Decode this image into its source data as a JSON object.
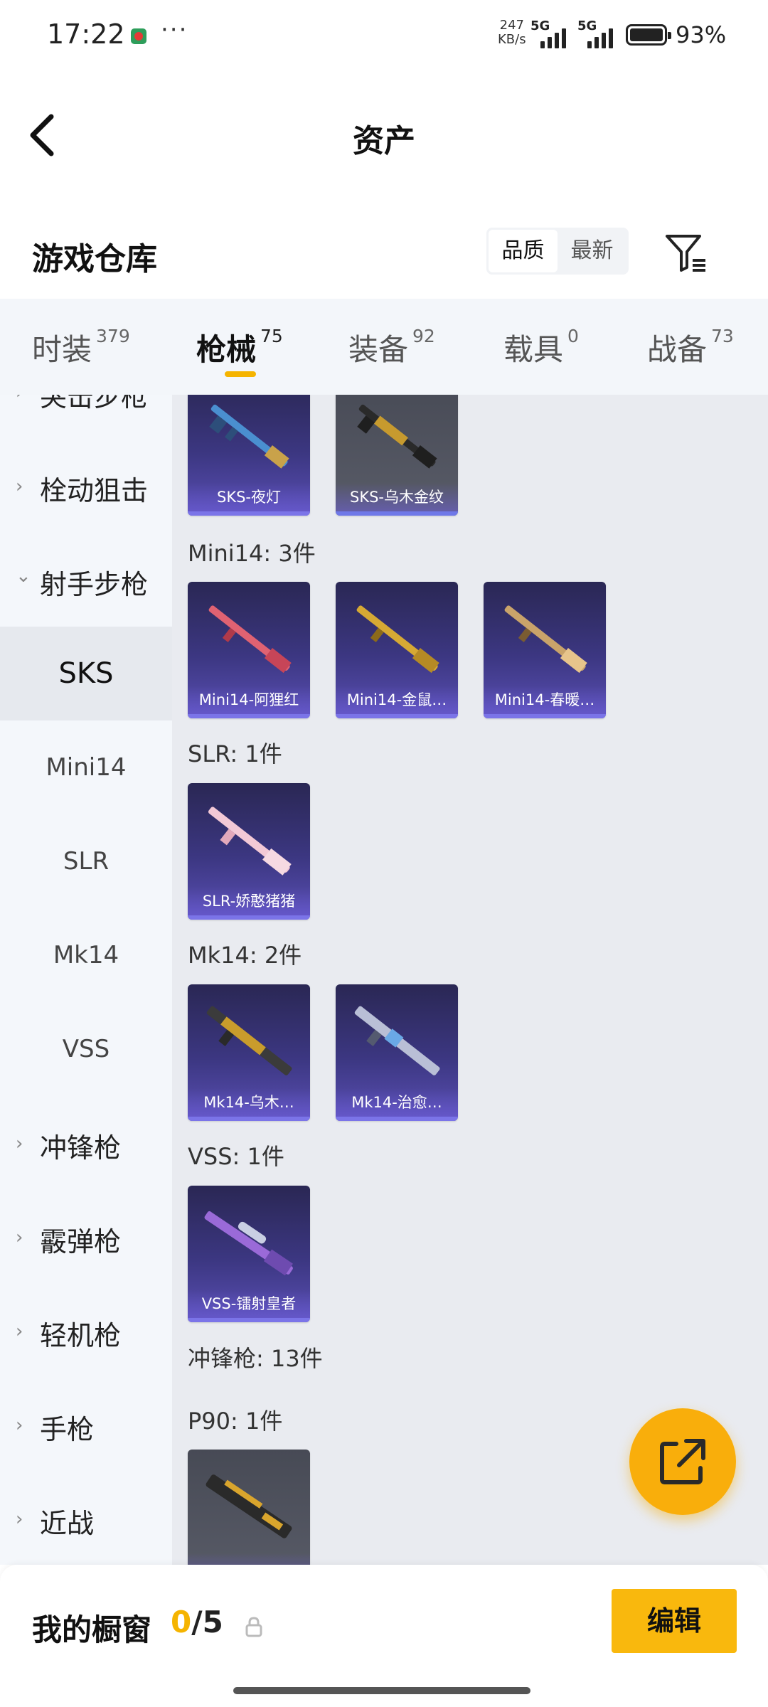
{
  "status_bar": {
    "time": "17:22",
    "more": "···",
    "net_speed_value": "247",
    "net_speed_unit": "KB/s",
    "signal_1": "5G",
    "signal_2": "5G",
    "battery": "93%",
    "battery_level": 0.93,
    "icons": [
      "notification-app-icon",
      "signal-icon",
      "battery-icon"
    ]
  },
  "header": {
    "title": "资产",
    "back_icon": "chevron-left-icon"
  },
  "warehouse": {
    "title": "游戏仓库",
    "sort_options": [
      "品质",
      "最新"
    ],
    "sort_active": "品质",
    "filter_icon": "filter-icon"
  },
  "tabs": [
    {
      "label": "时装",
      "count": "379"
    },
    {
      "label": "枪械",
      "count": "75",
      "active": true
    },
    {
      "label": "装备",
      "count": "92"
    },
    {
      "label": "载具",
      "count": "0"
    },
    {
      "label": "战备",
      "count": "73"
    }
  ],
  "sidebar": {
    "categories": [
      {
        "label": "突击步枪"
      },
      {
        "label": "栓动狙击"
      },
      {
        "label": "射手步枪",
        "expanded": true
      },
      {
        "label": "冲锋枪"
      },
      {
        "label": "霰弹枪"
      },
      {
        "label": "轻机枪"
      },
      {
        "label": "手枪"
      },
      {
        "label": "近战"
      }
    ],
    "subcategories": [
      {
        "label": "SKS",
        "active": true
      },
      {
        "label": "Mini14"
      },
      {
        "label": "SLR"
      },
      {
        "label": "Mk14"
      },
      {
        "label": "VSS"
      }
    ]
  },
  "content": {
    "sks_items": [
      {
        "name": "SKS-夜灯"
      },
      {
        "name": "SKS-乌木金纹"
      }
    ],
    "groups": [
      {
        "title": "Mini14: 3件",
        "items": [
          {
            "name": "Mini14-阿狸红"
          },
          {
            "name": "Mini14-金鼠…"
          },
          {
            "name": "Mini14-春暖…"
          }
        ]
      },
      {
        "title": "SLR: 1件",
        "items": [
          {
            "name": "SLR-娇憨猪猪"
          }
        ]
      },
      {
        "title": "Mk14: 2件",
        "items": [
          {
            "name": "Mk14-乌木…"
          },
          {
            "name": "Mk14-治愈…"
          }
        ]
      },
      {
        "title": "VSS: 1件",
        "items": [
          {
            "name": "VSS-镭射皇者"
          }
        ]
      },
      {
        "title": "冲锋枪: 13件",
        "items": []
      },
      {
        "title": "P90: 1件",
        "items": []
      }
    ]
  },
  "fab": {
    "icon": "share-icon"
  },
  "bottom_bar": {
    "label": "我的橱窗",
    "current": "0",
    "total": "/5",
    "lock_icon": "lock-icon",
    "edit_label": "编辑"
  },
  "colors": {
    "accent": "#f9b80d",
    "card_purple": "#3c3782",
    "card_gray": "#595c68"
  }
}
